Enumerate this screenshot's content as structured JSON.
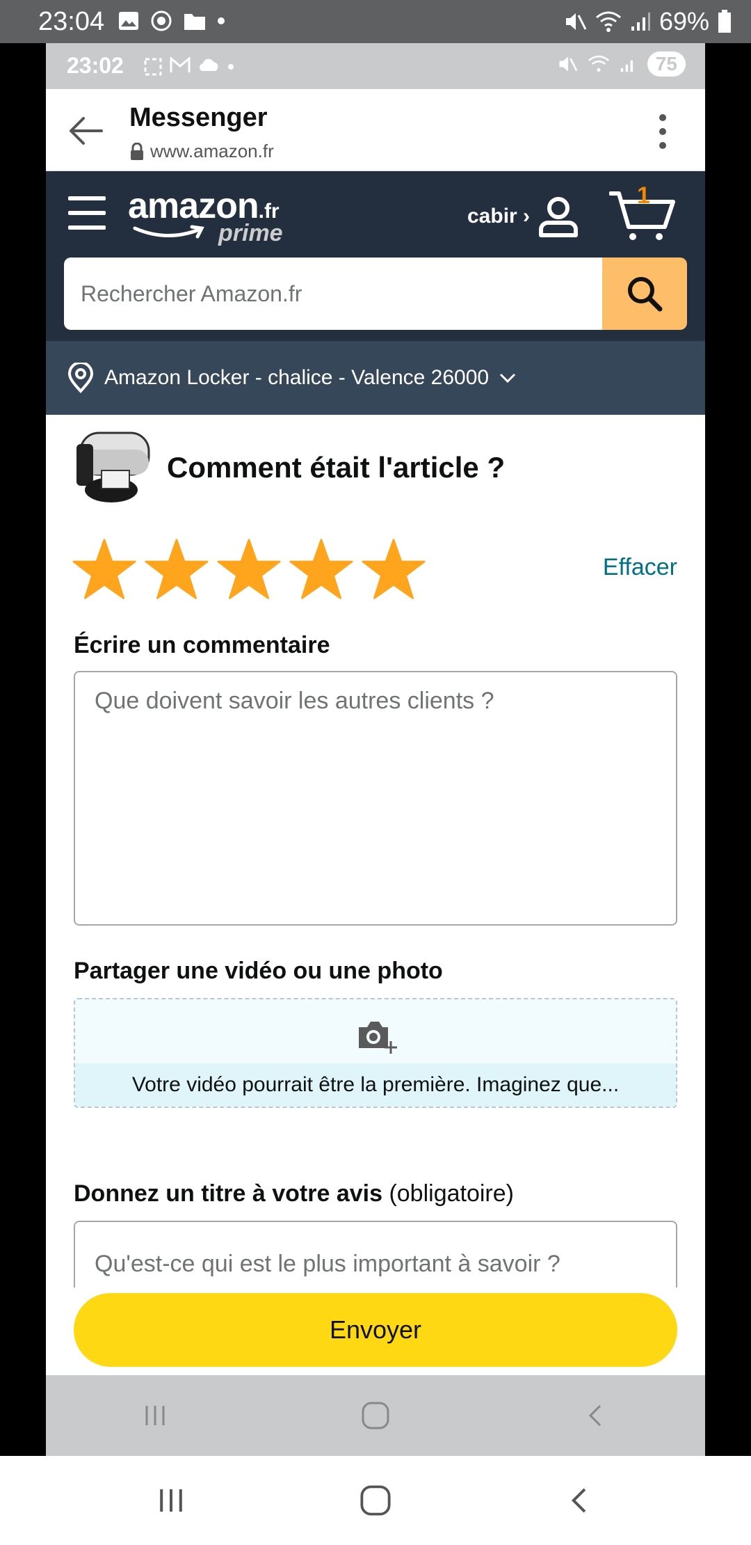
{
  "outer_status": {
    "time": "23:04",
    "battery": "69%",
    "icons": [
      "image-icon",
      "whatsapp-icon",
      "folder-icon",
      "dot-icon",
      "mute-icon",
      "wifi-icon",
      "signal-icon",
      "battery-icon"
    ]
  },
  "inner_status": {
    "time": "23:02",
    "badge": "75"
  },
  "browser": {
    "title": "Messenger",
    "url": "www.amazon.fr"
  },
  "header": {
    "logo_word": "amazon",
    "logo_tld": ".fr",
    "logo_sub": "prime",
    "account_label": "cabir ›",
    "cart_count": "1",
    "search_placeholder": "Rechercher Amazon.fr"
  },
  "location": {
    "label": "Amazon Locker - chalice - Valence 26000"
  },
  "review": {
    "heading": "Comment était l'article ?",
    "rating": 5,
    "rating_max": 5,
    "clear_label": "Effacer",
    "comment_label": "Écrire un commentaire",
    "comment_placeholder": "Que doivent savoir les autres clients ?",
    "media_label": "Partager une vidéo ou une photo",
    "media_hint": "Votre vidéo pourrait être la première. Imaginez que...",
    "title_label": "Donnez un titre à votre avis",
    "title_required": "(obligatoire)",
    "title_placeholder": "Qu'est-ce qui est le plus important à savoir ?",
    "submit_label": "Envoyer"
  },
  "colors": {
    "header_bg": "#232f3e",
    "location_bg": "#37475a",
    "star": "#ffa41c",
    "search_button": "#febd69",
    "submit_button": "#ffd814",
    "link": "#007185"
  }
}
